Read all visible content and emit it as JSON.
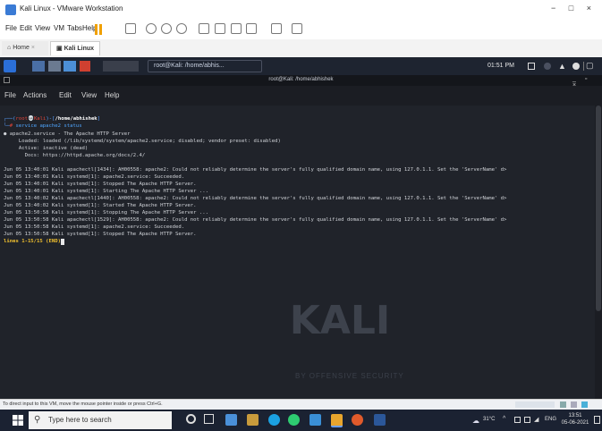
{
  "vmware": {
    "title": "Kali Linux - VMware Workstation",
    "window_controls": "− □ ×",
    "menu": [
      "File",
      "Edit",
      "View",
      "VM",
      "Tabs",
      "Help"
    ],
    "tabs": [
      {
        "label": "Home"
      },
      {
        "label": "Kali Linux"
      }
    ],
    "status_text": "To direct input to this VM, move the mouse pointer inside or press Ctrl+G."
  },
  "kali_panel": {
    "window_button": "root@Kali: /home/abhis...",
    "clock": "01:51 PM"
  },
  "terminal": {
    "title": "root@Kali: /home/abhishek",
    "menu": [
      "File",
      "Actions",
      "Edit",
      "View",
      "Help"
    ],
    "prompt_user": "root",
    "prompt_host": "Kali",
    "prompt_path": "/home/abhishek",
    "command": "service apache2 status",
    "lines": [
      "● apache2.service - The Apache HTTP Server",
      "     Loaded: loaded (/lib/systemd/system/apache2.service; disabled; vendor preset: disabled)",
      "     Active: inactive (dead)",
      "       Docs: https://httpd.apache.org/docs/2.4/",
      "",
      "Jun 05 13:40:01 Kali apachectl[1434]: AH00558: apache2: Could not reliably determine the server's fully qualified domain name, using 127.0.1.1. Set the 'ServerName' d>",
      "Jun 05 13:40:01 Kali systemd[1]: apache2.service: Succeeded.",
      "Jun 05 13:40:01 Kali systemd[1]: Stopped The Apache HTTP Server.",
      "Jun 05 13:40:01 Kali systemd[1]: Starting The Apache HTTP Server ...",
      "Jun 05 13:40:02 Kali apachectl[1440]: AH00558: apache2: Could not reliably determine the server's fully qualified domain name, using 127.0.1.1. Set the 'ServerName' d>",
      "Jun 05 13:40:02 Kali systemd[1]: Started The Apache HTTP Server.",
      "Jun 05 13:50:58 Kali systemd[1]: Stopping The Apache HTTP Server ...",
      "Jun 05 13:50:58 Kali apachectl[1529]: AH00558: apache2: Could not reliably determine the server's fully qualified domain name, using 127.0.1.1. Set the 'ServerName' d>",
      "Jun 05 13:50:58 Kali systemd[1]: apache2.service: Succeeded.",
      "Jun 05 13:50:58 Kali systemd[1]: Stopped The Apache HTTP Server."
    ],
    "pager_status": "lines 1-15/15 (END)",
    "watermark": "KALI",
    "watermark_sub": "BY OFFENSIVE SECURITY"
  },
  "taskbar": {
    "search_placeholder": "Type here to search",
    "weather": "31°C",
    "lang": "ENG",
    "time": "13:51",
    "date": "05-06-2021"
  },
  "colors": {
    "terminal_bg": "#20232a",
    "prompt_red": "#e0463a",
    "command_blue": "#4fa6ff",
    "end_yellow": "#f2c12e",
    "taskbar_bg": "#1b2232"
  }
}
